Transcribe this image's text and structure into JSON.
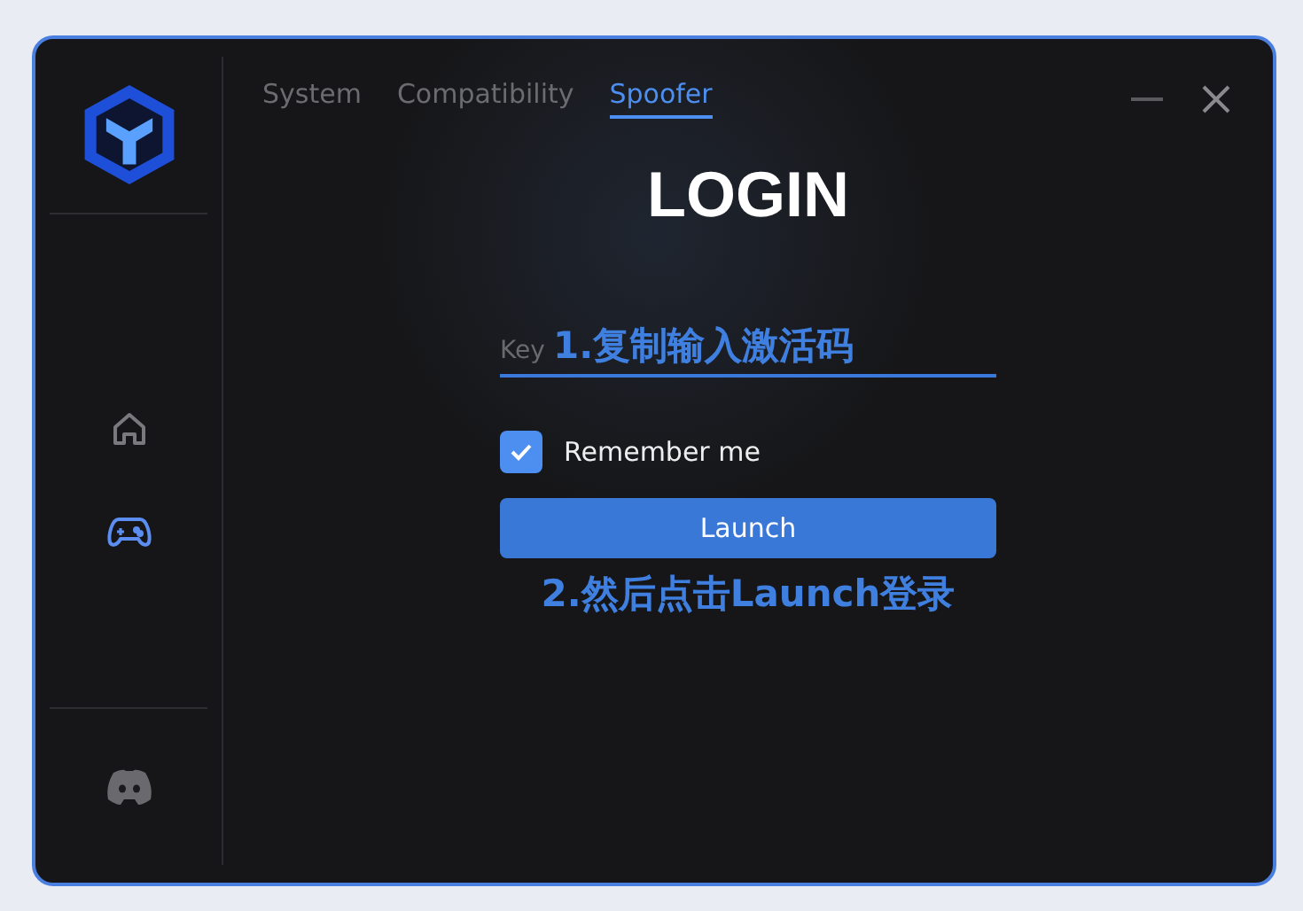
{
  "tabs": [
    {
      "label": "System",
      "selected": false
    },
    {
      "label": "Compatibility",
      "selected": false
    },
    {
      "label": "Spoofer",
      "selected": true
    }
  ],
  "sidebar": {
    "items": [
      {
        "kind": "home",
        "selected": false
      },
      {
        "kind": "gamepad",
        "selected": true
      }
    ],
    "footer": {
      "kind": "discord"
    }
  },
  "title": "LOGIN",
  "key_field": {
    "placeholder": "Key",
    "annotation": "1.复制输入激活码"
  },
  "remember": {
    "label": "Remember me",
    "checked": true
  },
  "launch_button": "Launch",
  "annotation": "2.然后点击Launch登录"
}
